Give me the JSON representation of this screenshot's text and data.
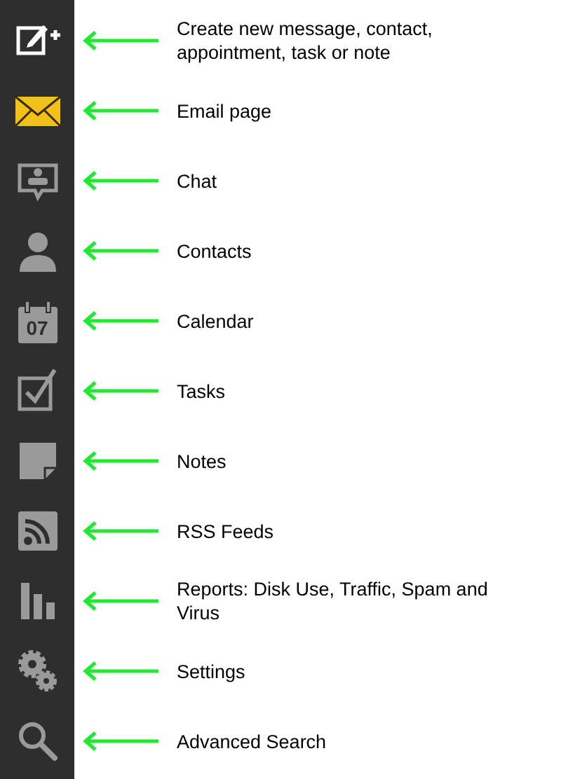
{
  "items": [
    {
      "label": "Create new message, contact, appointment, task or note",
      "selected": false
    },
    {
      "label": "Email page",
      "selected": true
    },
    {
      "label": "Chat",
      "selected": false
    },
    {
      "label": "Contacts",
      "selected": false
    },
    {
      "label": "Calendar",
      "selected": false,
      "icon_text": "07"
    },
    {
      "label": "Tasks",
      "selected": false
    },
    {
      "label": "Notes",
      "selected": false
    },
    {
      "label": "RSS Feeds",
      "selected": false
    },
    {
      "label": "Reports: Disk Use, Traffic, Spam and Virus",
      "selected": false
    },
    {
      "label": "Settings",
      "selected": false
    },
    {
      "label": "Advanced Search",
      "selected": false
    }
  ]
}
